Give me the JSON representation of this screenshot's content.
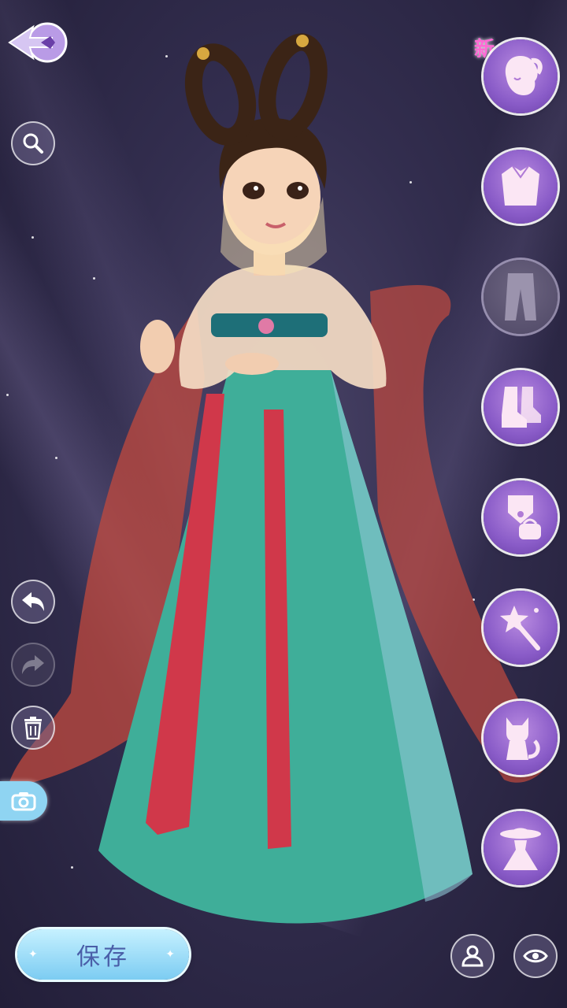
{
  "left_bar": {
    "back": {
      "icon": "back-arrow-icon"
    },
    "zoom": {
      "icon": "magnifier-icon"
    },
    "undo": {
      "icon": "undo-icon",
      "enabled": true
    },
    "redo": {
      "icon": "redo-icon",
      "enabled": false
    },
    "delete": {
      "icon": "trash-icon"
    },
    "camera": {
      "icon": "camera-icon"
    }
  },
  "right_bar": {
    "new_badge": "新",
    "categories": [
      {
        "id": "hair",
        "icon": "hair-icon"
      },
      {
        "id": "top",
        "icon": "top-icon"
      },
      {
        "id": "bottom",
        "icon": "pants-icon",
        "selected": false
      },
      {
        "id": "shoes",
        "icon": "boots-icon"
      },
      {
        "id": "accessories",
        "icon": "necklace-bag-icon"
      },
      {
        "id": "effects",
        "icon": "magic-wand-icon"
      },
      {
        "id": "pet",
        "icon": "cat-icon"
      },
      {
        "id": "suit",
        "icon": "hat-dress-icon"
      }
    ]
  },
  "bottom_bar": {
    "save_label": "保存",
    "wardrobe_icon": "hanger-icon",
    "view_icon": "eye-icon"
  },
  "colors": {
    "background": "#332e4f",
    "category_button": "#8a5cc8",
    "save_button": "#7cccf2",
    "new_badge": "#ff6ad5"
  }
}
